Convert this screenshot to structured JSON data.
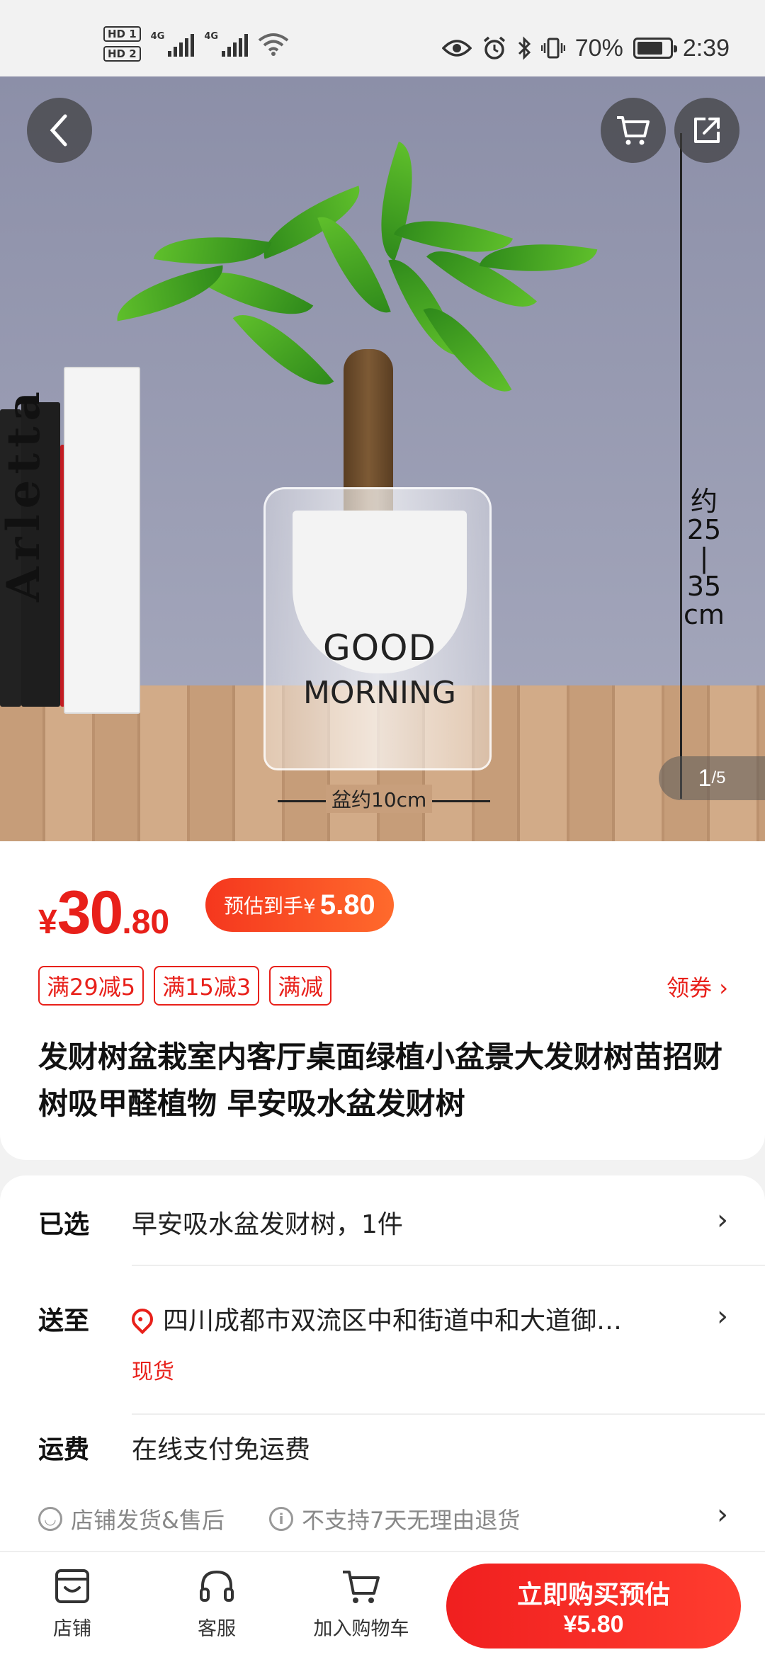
{
  "status_bar": {
    "hd1": "HD 1",
    "hd2": "HD 2",
    "net1": "4G",
    "net2": "4G",
    "battery_pct": "70%",
    "time": "2:39"
  },
  "gallery": {
    "counter_current": "1",
    "counter_total": "/5",
    "book_spine": "Arletta",
    "pot_text_line1": "GOOD",
    "pot_text_line2": "MORNING",
    "height_label": "约 25 | 35 cm",
    "width_label": "盆约10cm"
  },
  "price": {
    "currency": "¥",
    "integer": "30",
    "decimal": ".80",
    "estimate_label": "预估到手¥",
    "estimate_value": "5.80"
  },
  "coupons": [
    "满29减5",
    "满15减3",
    "满减"
  ],
  "get_coupon_label": "领券 ›",
  "product_title": "发财树盆栽室内客厅桌面绿植小盆景大发财树苗招财树吸甲醛植物 早安吸水盆发财树",
  "info": {
    "selected_label": "已选",
    "selected_value": "早安吸水盆发财树，1件",
    "ship_label": "送至",
    "ship_value": "四川成都市双流区中和街道中和大道御…",
    "in_stock": "现货",
    "freight_label": "运费",
    "freight_value": "在线支付免运费",
    "service1": "店铺发货&售后",
    "service2": "不支持7天无理由退货",
    "chevron": "›"
  },
  "bottom_bar": {
    "store": "店铺",
    "service": "客服",
    "cart": "加入购物车",
    "buy_line1": "立即购买预估",
    "buy_line2": "¥5.80"
  },
  "colors": {
    "accent": "#e8201a",
    "buy_gradient_start": "#f01f1f",
    "buy_gradient_end": "#ff3d2f"
  }
}
